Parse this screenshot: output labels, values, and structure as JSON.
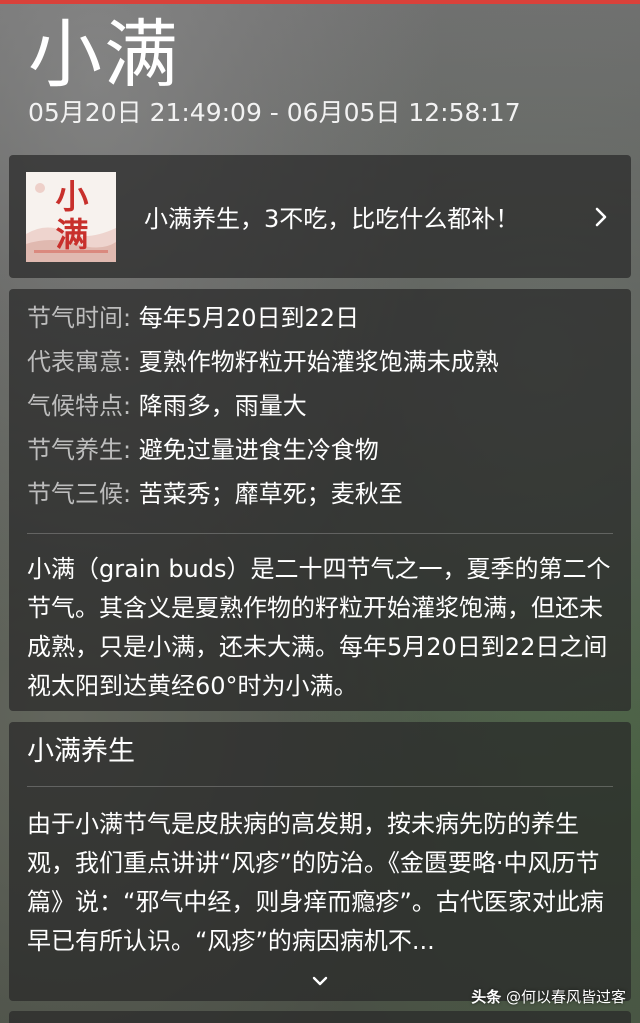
{
  "header": {
    "title": "小满",
    "date_range": "05月20日 21:49:09 - 06月05日 12:58:17"
  },
  "article": {
    "thumbnail_text": "小满",
    "title": "小满养生，3不吃，比吃什么都补！",
    "chevron_icon": "chevron-right-icon"
  },
  "info": {
    "rows": [
      {
        "label": "节气时间:",
        "value": "每年5月20日到22日"
      },
      {
        "label": "代表寓意:",
        "value": "夏熟作物籽粒开始灌浆饱满未成熟"
      },
      {
        "label": "气候特点:",
        "value": "降雨多，雨量大"
      },
      {
        "label": "节气养生:",
        "value": "避免过量进食生冷食物"
      },
      {
        "label": "节气三候:",
        "value": "苦菜秀；靡草死；麦秋至"
      }
    ],
    "description": "小满（grain buds）是二十四节气之一，夏季的第二个节气。其含义是夏熟作物的籽粒开始灌浆饱满，但还未成熟，只是小满，还未大满。每年5月20日到22日之间视太阳到达黄经60°时为小满。"
  },
  "health": {
    "title": "小满养生",
    "body": "由于小满节气是皮肤病的高发期，按未病先防的养生观，我们重点讲讲“风疹”的防治。《金匮要略·中风历节篇》说：“邪气中经，则身痒而瘾疹”。古代医家对此病早已有所认识。“风疹”的病因病机不...",
    "expand_icon": "chevron-down-icon"
  },
  "watermark": {
    "brand": "头条",
    "handle": "@何以春风皆过客"
  },
  "colors": {
    "accent_strip": "#d9413a",
    "card_background": "rgba(40,40,40,0.72)",
    "label_gray": "#bdbdbd",
    "thumbnail_red": "#c8302c"
  }
}
